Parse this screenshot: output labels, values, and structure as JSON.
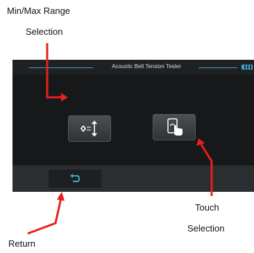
{
  "callouts": {
    "minmax_line1": "Min/Max Range",
    "minmax_line2": "Selection",
    "touch_line1": "Touch",
    "touch_line2": "Selection",
    "return": "Return"
  },
  "device": {
    "title": "Acoustic Belt Tension Tester",
    "battery_icon": "battery-icon",
    "buttons": [
      {
        "name": "min-max-range-button",
        "icon": "range-arrows-icon"
      },
      {
        "name": "touch-selection-button",
        "icon": "touch-hand-icon"
      },
      {
        "name": "return-button",
        "icon": "return-arrow-icon"
      }
    ]
  },
  "colors": {
    "annotation_arrow": "#e8201c",
    "accent": "#3fa7d6",
    "screen_bg": "#16181a"
  }
}
